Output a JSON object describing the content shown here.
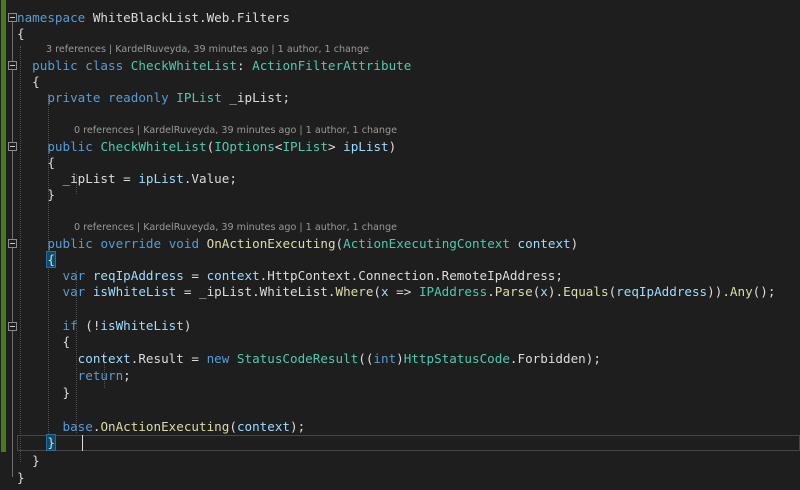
{
  "code": {
    "l1": [
      "namespace",
      " WhiteBlackList.Web.Filters"
    ],
    "l2": "{",
    "l3_lens": "3 references | KardelRuveyda, 39 minutes ago | 1 author, 1 change",
    "l3": [
      "public",
      " ",
      "class",
      " ",
      "CheckWhiteList",
      ": ",
      "ActionFilterAttribute"
    ],
    "l4": "{",
    "l5": [
      "private",
      " ",
      "readonly",
      " ",
      "IPList",
      " _ipList;"
    ],
    "l7_lens": "0 references | KardelRuveyda, 39 minutes ago | 1 author, 1 change",
    "l7": [
      "public",
      " ",
      "CheckWhiteList",
      "(",
      "IOptions",
      "<",
      "IPList",
      "> ",
      "ipList",
      ")"
    ],
    "l8": "{",
    "l9": [
      "_ipList = ",
      "ipList",
      ".Value;"
    ],
    "l10": "}",
    "l12_lens": "0 references | KardelRuveyda, 39 minutes ago | 1 author, 1 change",
    "l12": [
      "public",
      " ",
      "override",
      " ",
      "void",
      " ",
      "OnActionExecuting",
      "(",
      "ActionExecutingContext",
      " ",
      "context",
      ")"
    ],
    "l13": "{",
    "l14": [
      "var",
      " ",
      "reqIpAddress",
      " = ",
      "context",
      ".HttpContext.Connection.RemoteIpAddress;"
    ],
    "l15": [
      "var",
      " ",
      "isWhiteList",
      " = _ipList.WhiteList.",
      "Where",
      "(",
      "x",
      " => ",
      "IPAddress",
      ".",
      "Parse",
      "(",
      "x",
      ").",
      "Equals",
      "(",
      "reqIpAddress",
      ")).",
      "Any",
      "();"
    ],
    "l17": [
      "if",
      " (!",
      "isWhiteList",
      ")"
    ],
    "l18": "{",
    "l19": [
      "context",
      ".Result = ",
      "new",
      " ",
      "StatusCodeResult",
      "((",
      "int",
      ")",
      "HttpStatusCode",
      ".Forbidden);"
    ],
    "l20": [
      "return",
      ";"
    ],
    "l21": "}",
    "l23": [
      "base",
      ".",
      "OnActionExecuting",
      "(",
      "context",
      ");"
    ],
    "l24": "}",
    "l25": "}",
    "l26": "}"
  }
}
